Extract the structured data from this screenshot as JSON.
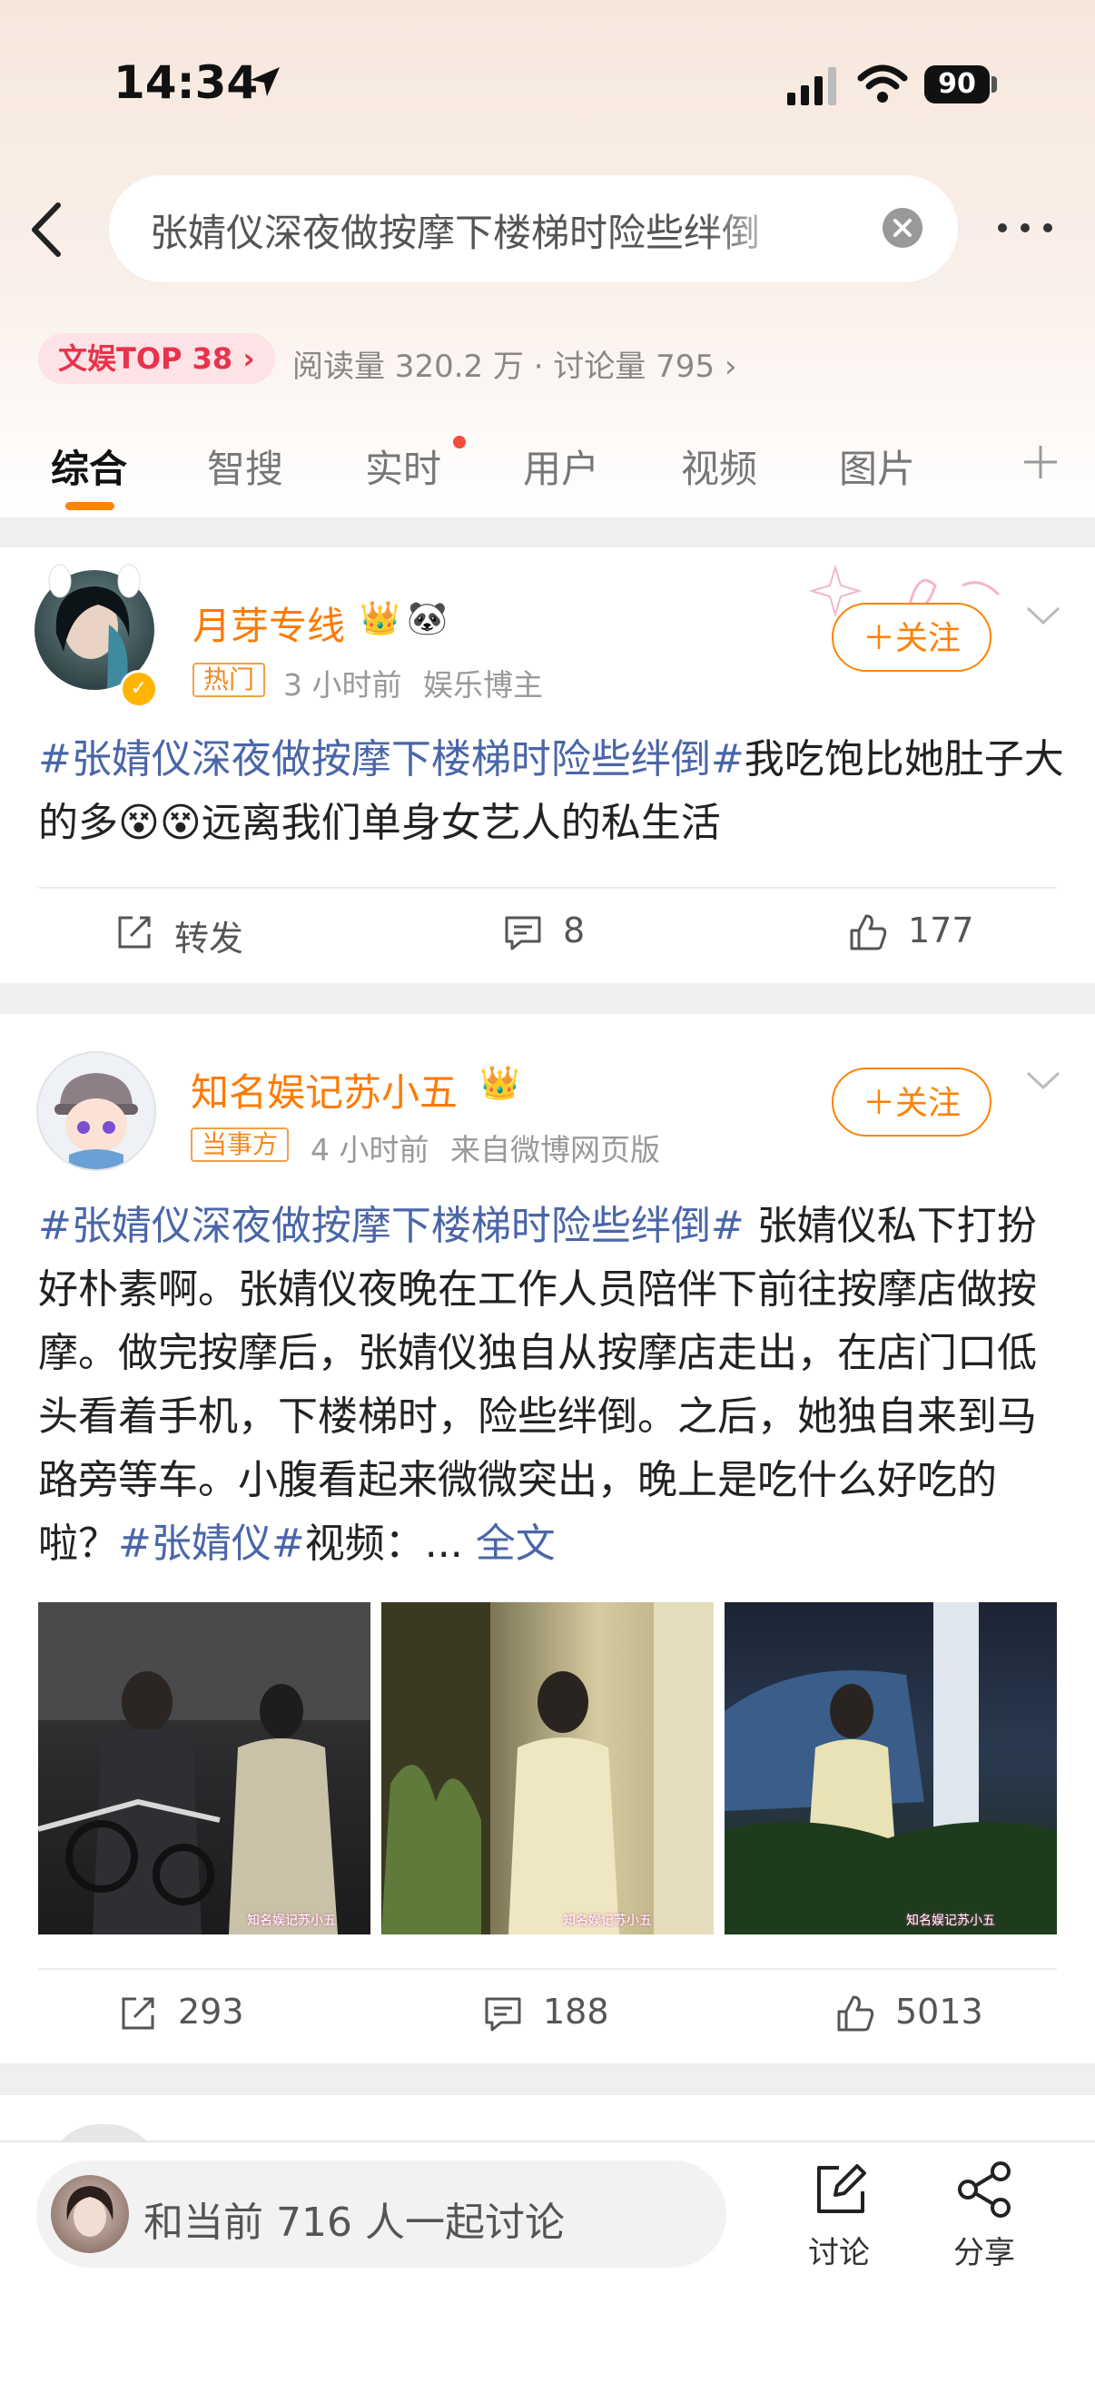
{
  "status_bar": {
    "time": "14:34",
    "battery": "90"
  },
  "search": {
    "query": "张婧仪深夜做按摩下楼梯时险些绊倒"
  },
  "topic": {
    "badge": "文娱TOP 38",
    "stats": "阅读量 320.2 万 · 讨论量 795"
  },
  "tabs": [
    {
      "label": "综合",
      "active": true
    },
    {
      "label": "智搜"
    },
    {
      "label": "实时",
      "dot": true
    },
    {
      "label": "用户"
    },
    {
      "label": "视频"
    },
    {
      "label": "图片"
    }
  ],
  "posts": [
    {
      "username": "月芽专线",
      "tag": "热门",
      "time": "3 小时前",
      "source": "娱乐博主",
      "follow_label": "关注",
      "hashtag": "#张婧仪深夜做按摩下楼梯时险些绊倒#",
      "text_part1": "我吃饱比她肚子大的多",
      "text_part2": "远离我们单身女艺人的私生活",
      "repost_label": "转发",
      "comments": "8",
      "likes": "177"
    },
    {
      "username": "知名娱记苏小五",
      "tag": "当事方",
      "time": "4 小时前",
      "source": "来自微博网页版",
      "follow_label": "关注",
      "hashtag": "#张婧仪深夜做按摩下楼梯时险些绊倒#",
      "text": " 张婧仪私下打扮好朴素啊。张婧仪夜晚在工作人员陪伴下前往按摩店做按摩。做完按摩后，张婧仪独自从按摩店走出，在店门口低头看着手机，下楼梯时，险些绊倒。之后，她独自来到马路旁等车。小腹看起来微微突出，晚上是吃什么好吃的啦？",
      "hashtag2": "#张婧仪#",
      "text_tail": "视频：...",
      "full_text_link": "全文",
      "watermark": "知名娱记苏小五",
      "reposts": "293",
      "comments": "188",
      "likes": "5013"
    }
  ],
  "bottom": {
    "discuss_placeholder": "和当前 716 人一起讨论",
    "discuss_label": "讨论",
    "share_label": "分享"
  }
}
